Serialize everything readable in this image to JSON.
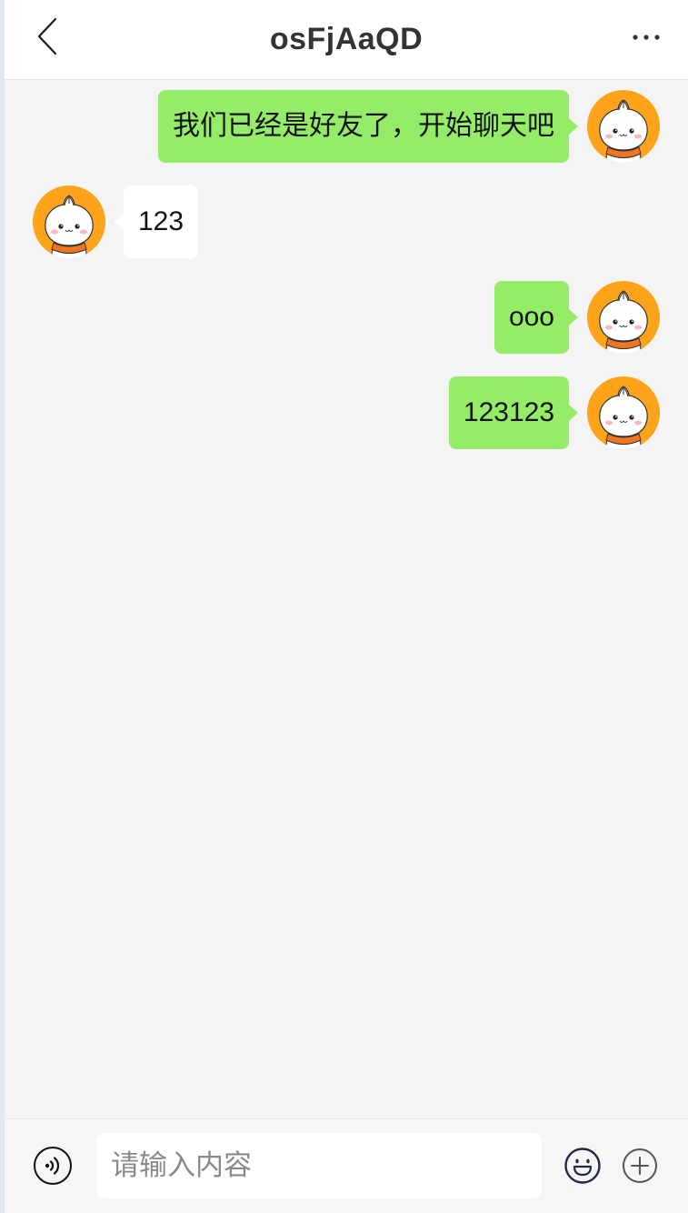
{
  "header": {
    "title": "osFjAaQD",
    "back_icon": "chevron-left-icon",
    "more_icon": "more-dots-icon"
  },
  "participants": {
    "self": {
      "avatar": "steamed-bun-avatar"
    },
    "other": {
      "avatar": "steamed-bun-avatar"
    }
  },
  "messages": [
    {
      "sender": "self",
      "text": "我们已经是好友了，开始聊天吧"
    },
    {
      "sender": "other",
      "text": "123"
    },
    {
      "sender": "self",
      "text": "ooo"
    },
    {
      "sender": "self",
      "text": "123123"
    }
  ],
  "input_bar": {
    "voice_icon": "voice-icon",
    "placeholder": "请输入内容",
    "value": "",
    "emoji_icon": "emoji-icon",
    "plus_icon": "plus-icon"
  },
  "colors": {
    "header_background": "#ffffff",
    "chat_background": "#f4f4f4",
    "self_bubble": "#95ec69",
    "other_bubble": "#ffffff",
    "avatar_background": "#ffa31a",
    "input_bar_background": "#f6f6f6"
  }
}
